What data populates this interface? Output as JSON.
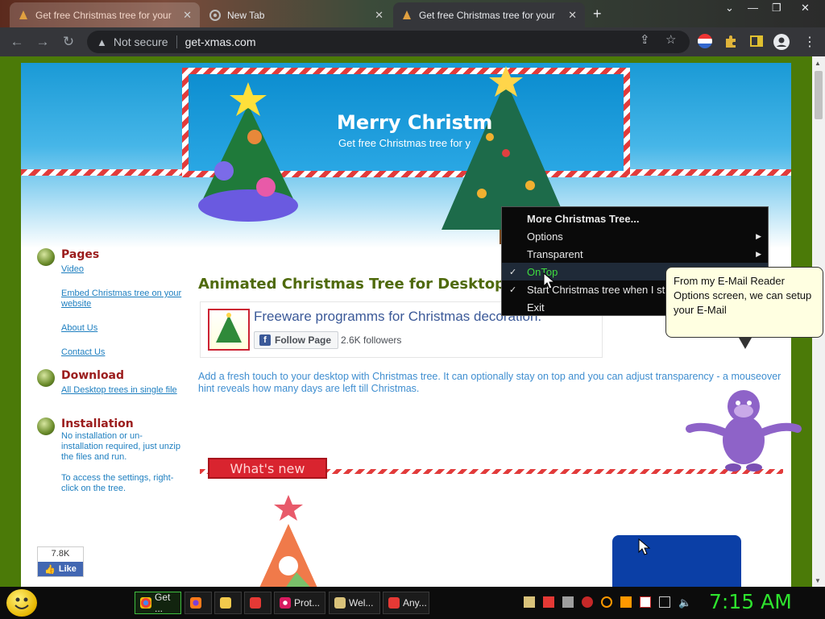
{
  "browser": {
    "tabs": [
      {
        "title": "Get free Christmas tree for your",
        "active": false
      },
      {
        "title": "New Tab",
        "active": false
      },
      {
        "title": "Get free Christmas tree for your",
        "active": true
      }
    ],
    "new_tab": "+",
    "address": {
      "security": "Not secure",
      "url": "get-xmas.com"
    }
  },
  "page": {
    "banner_title": "Merry Christm",
    "banner_subtitle": "Get free Christmas tree for y",
    "sidebar": {
      "pages_heading": "Pages",
      "pages_links": [
        "Video",
        "Embed Christmas tree on your website",
        "About Us",
        "Contact Us"
      ],
      "download_heading": "Download",
      "download_link": "All Desktop trees in single file",
      "installation_heading": "Installation",
      "installation_text": "No installation or un-installation required, just unzip the files and run.",
      "installation_text2": "To access the settings, right-click on the tree."
    },
    "title": "Animated Christmas Tree for Desktop",
    "facebook": {
      "page_name": "Freeware programms for Christmas decoration.",
      "follow_label": "Follow Page",
      "followers": "2.6K followers"
    },
    "description": "Add a fresh touch to your desktop with Christmas tree. It can optionally stay on top and you can adjust transparency - a mouseover hint reveals how many days are left till Christmas.",
    "whats_new": "What's new",
    "like": {
      "count": "7.8K",
      "label": "Like"
    }
  },
  "context_menu": {
    "items": [
      {
        "label": "More Christmas Tree...",
        "checked": false,
        "submenu": false
      },
      {
        "label": "Options",
        "checked": false,
        "submenu": true
      },
      {
        "label": "Transparent",
        "checked": false,
        "submenu": true
      },
      {
        "label": "OnTop",
        "checked": true,
        "submenu": false
      },
      {
        "label": "Start Christmas tree when I st",
        "checked": true,
        "submenu": false
      },
      {
        "label": "Exit",
        "checked": false,
        "submenu": false
      }
    ]
  },
  "tooltip": {
    "text": "From my E-Mail Reader Options screen, we can setup your E-Mail"
  },
  "taskbar": {
    "buttons": [
      {
        "label": "Get ...",
        "active": true
      },
      {
        "label": "",
        "active": false
      },
      {
        "label": "",
        "active": false
      },
      {
        "label": "",
        "active": false
      },
      {
        "label": "Prot...",
        "active": false
      },
      {
        "label": "Wel...",
        "active": false
      },
      {
        "label": "Any...",
        "active": false
      }
    ],
    "clock": "7:15 AM"
  },
  "colors": {
    "accent_green": "#4b7a08",
    "clock_green": "#2ee32e",
    "heading_red": "#9b1c1c",
    "link_blue": "#1e7fc0"
  }
}
